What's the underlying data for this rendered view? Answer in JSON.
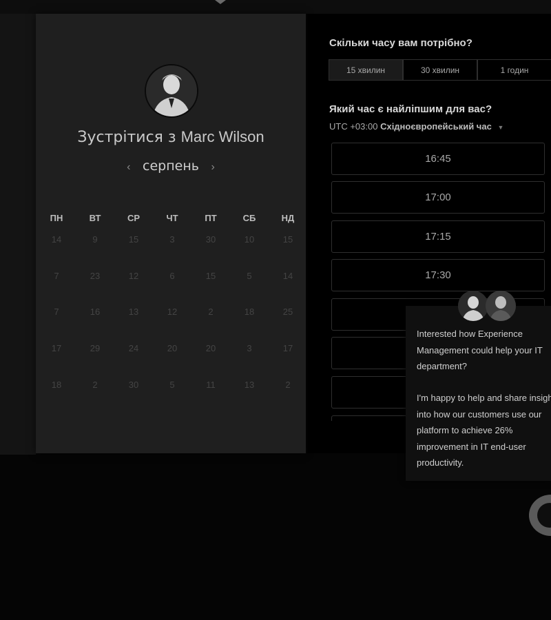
{
  "calendar": {
    "title_prefix": "Зустрітися з",
    "host_name": "Marc Wilson",
    "month": "серпень",
    "prev_arrow": "‹",
    "next_arrow": "›",
    "weekdays": [
      "ПН",
      "ВТ",
      "СР",
      "ЧТ",
      "ПТ",
      "СБ",
      "НД"
    ],
    "weeks": [
      [
        "14",
        "9",
        "15",
        "3",
        "30",
        "10",
        "15"
      ],
      [
        "7",
        "23",
        "12",
        "6",
        "15",
        "5",
        "14"
      ],
      [
        "7",
        "16",
        "13",
        "12",
        "2",
        "18",
        "25"
      ],
      [
        "17",
        "29",
        "24",
        "20",
        "20",
        "3",
        "17"
      ],
      [
        "18",
        "2",
        "30",
        "5",
        "11",
        "13",
        "2"
      ]
    ]
  },
  "booking": {
    "duration_question": "Скільки часу вам потрібно?",
    "durations": [
      "15 хвилин",
      "30 хвилин",
      "1 годин"
    ],
    "time_question": "Який час є найліпшим для вас?",
    "timezone_offset": "UTC +03:00",
    "timezone_name": "Східноєвропейський час",
    "slots": [
      "16:45",
      "17:00",
      "17:15",
      "17:30",
      "",
      "",
      ""
    ]
  },
  "chat": {
    "message_1": "Interested how Experience Management could help your IT department?",
    "message_2": "I'm happy to help and share insight into how our customers use our platform to achieve 26% improvement in IT end-user productivity."
  }
}
